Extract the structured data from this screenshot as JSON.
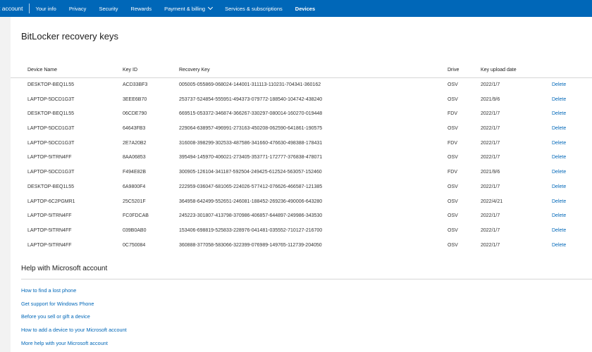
{
  "topbar": {
    "brand": "t account",
    "nav": [
      "Your info",
      "Privacy",
      "Security",
      "Rewards",
      "Payment & billing",
      "Services & subscriptions",
      "Devices"
    ]
  },
  "page": {
    "title": "BitLocker recovery keys"
  },
  "table": {
    "headers": [
      "Device Name",
      "Key ID",
      "Recovery Key",
      "Drive",
      "Key upload date"
    ],
    "action_label": "Delete",
    "rows": [
      [
        "DESKTOP-BEQ1L55",
        "ACD33BF3",
        "005005-055869-068024-144001-311113-110231-704341-360162",
        "OSV",
        "2022/1/7"
      ],
      [
        "LAPTOP-5DCD1G3T",
        "3EEE6B70",
        "253737-524854-555951-494373-079772-188540-104742-438240",
        "OSV",
        "2021/9/6"
      ],
      [
        "DESKTOP-BEQ1L55",
        "06CDE790",
        "669515-053372-346874-366267-330297-080014-160270-019448",
        "FDV",
        "2022/1/7"
      ],
      [
        "LAPTOP-5DCD1G3T",
        "64643FB3",
        "229064-638957-496991-273163-450208-062590-641861-190575",
        "OSV",
        "2022/1/7"
      ],
      [
        "LAPTOP-5DCD1G3T",
        "2E7A20B2",
        "316008-398299-302533-487586-341660-476630-498388-178431",
        "FDV",
        "2022/1/7"
      ],
      [
        "LAPTOP-5ITRN4FF",
        "8AA06853",
        "395494-145970-406021-273405-353771-172777-376838-478071",
        "OSV",
        "2022/1/7"
      ],
      [
        "LAPTOP-5DCD1G3T",
        "F494E82B",
        "300905-126104-341187-592504-249425-612524-563057-152460",
        "FDV",
        "2021/9/6"
      ],
      [
        "DESKTOP-BEQ1L55",
        "6A9800F4",
        "222959-036047-681065-224026-577412-076626-466587-121385",
        "OSV",
        "2022/1/7"
      ],
      [
        "LAPTOP-6C2PGMR1",
        "25C5201F",
        "364958-642499-552651-246081-188452-269236-490006-643280",
        "OSV",
        "2022/4/21"
      ],
      [
        "LAPTOP-5ITRN4FF",
        "FC0FDCAB",
        "245223-301807-413798-370986-406857-644897-249986-343530",
        "OSV",
        "2022/1/7"
      ],
      [
        "LAPTOP-5ITRN4FF",
        "039B0AB0",
        "153406-698819-525833-228976-041481-035552-710127-216700",
        "OSV",
        "2022/1/7"
      ],
      [
        "LAPTOP-5ITRN4FF",
        "0C750084",
        "360888-377058-583066-322399-076989-149765-112739-204050",
        "OSV",
        "2022/1/7"
      ]
    ]
  },
  "help": {
    "title": "Help with Microsoft account",
    "links": [
      "How to find a lost phone",
      "Get support for Windows Phone",
      "Before you sell or gift a device",
      "How to add a device to your Microsoft account",
      "More help with your Microsoft account"
    ]
  },
  "colors": {
    "accent": "#0067b8",
    "background": "#f2f2f2",
    "card": "#ffffff"
  }
}
